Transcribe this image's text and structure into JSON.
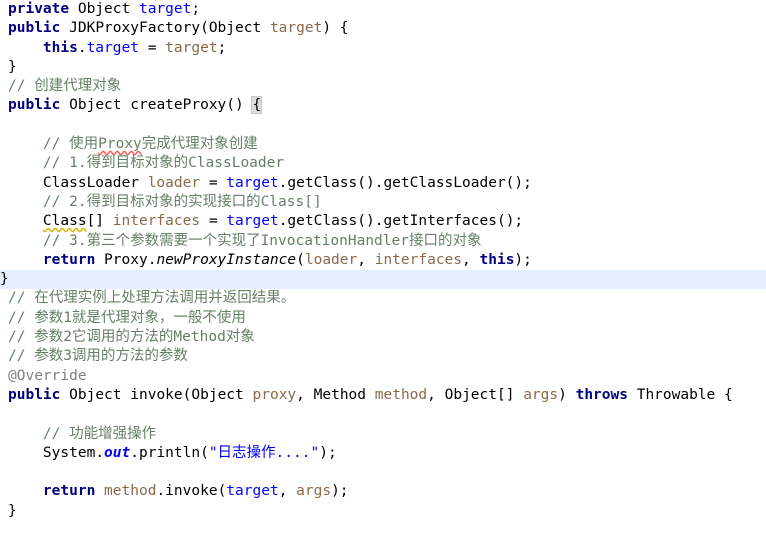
{
  "editor": {
    "language": "Java",
    "theme": "IntelliJ Light",
    "font": "monospace",
    "colors": {
      "background": "#ffffff",
      "foreground": "#000000",
      "keyword": "#000080",
      "field": "#660e7a",
      "field_blue": "#0000ff",
      "parameter": "#8a6a4a",
      "static_field": "#0000ff",
      "string": "#0000ff",
      "comment": "#668066",
      "annotation": "#808080",
      "caret_line_highlight": "#e5efff",
      "brace_match": "#dcdcdc",
      "squiggle_spelling": "#ff5555",
      "squiggle_warning": "#d8b400"
    },
    "highlighted_line_number": 12
  },
  "code": {
    "lines": [
      {
        "n": 1,
        "indent": 0,
        "text": "private Object target;"
      },
      {
        "n": 2,
        "indent": 0,
        "text": "public JDKProxyFactory(Object target) {"
      },
      {
        "n": 3,
        "indent": 1,
        "text": "this.target = target;"
      },
      {
        "n": 4,
        "indent": 0,
        "text": "}"
      },
      {
        "n": 5,
        "indent": 0,
        "text": "// 创建代理对象"
      },
      {
        "n": 6,
        "indent": 0,
        "text": "public Object createProxy() {"
      },
      {
        "n": 7,
        "indent": 0,
        "text": ""
      },
      {
        "n": 8,
        "indent": 1,
        "text": "// 使用Proxy完成代理对象创建"
      },
      {
        "n": 9,
        "indent": 1,
        "text": "// 1.得到目标对象的ClassLoader"
      },
      {
        "n": 10,
        "indent": 1,
        "text": "ClassLoader loader = target.getClass().getClassLoader();"
      },
      {
        "n": 11,
        "indent": 1,
        "text": "// 2.得到目标对象的实现接口的Class[]"
      },
      {
        "n": 12,
        "indent": 1,
        "text": "Class[] interfaces = target.getClass().getInterfaces();"
      },
      {
        "n": 13,
        "indent": 1,
        "text": "// 3.第三个参数需要一个实现了InvocationHandler接口的对象"
      },
      {
        "n": 14,
        "indent": 1,
        "text": "return Proxy.newProxyInstance(loader, interfaces, this);"
      },
      {
        "n": 15,
        "indent": 0,
        "text": "}"
      },
      {
        "n": 16,
        "indent": 0,
        "text": "// 在代理实例上处理方法调用并返回结果。"
      },
      {
        "n": 17,
        "indent": 0,
        "text": "// 参数1就是代理对象，一般不使用"
      },
      {
        "n": 18,
        "indent": 0,
        "text": "// 参数2它调用的方法的Method对象"
      },
      {
        "n": 19,
        "indent": 0,
        "text": "// 参数3调用的方法的参数"
      },
      {
        "n": 20,
        "indent": 0,
        "text": "@Override"
      },
      {
        "n": 21,
        "indent": 0,
        "text": "public Object invoke(Object proxy, Method method, Object[] args) throws Throwable {"
      },
      {
        "n": 22,
        "indent": 0,
        "text": ""
      },
      {
        "n": 23,
        "indent": 1,
        "text": "// 功能增强操作"
      },
      {
        "n": 24,
        "indent": 1,
        "text": "System.out.println(\"日志操作....\");"
      },
      {
        "n": 25,
        "indent": 0,
        "text": ""
      },
      {
        "n": 26,
        "indent": 1,
        "text": "return method.invoke(target, args);"
      },
      {
        "n": 27,
        "indent": 0,
        "text": "}"
      }
    ],
    "tokens": {
      "kw_private": "private",
      "kw_public": "public",
      "kw_return": "return",
      "kw_this": "this",
      "kw_throws": "throws",
      "type_object": "Object",
      "type_classloader": "ClassLoader",
      "type_class": "Class",
      "type_method": "Method",
      "type_proxy": "Proxy",
      "type_system": "System",
      "type_throwable": "Throwable",
      "field_target": "target",
      "var_loader": "loader",
      "var_interfaces": "interfaces",
      "param_proxy": "proxy",
      "param_method": "method",
      "param_args": "args",
      "ctor_name": "JDKProxyFactory",
      "m_createProxy": "createProxy",
      "m_getClass": "getClass",
      "m_getClassLoader": "getClassLoader",
      "m_getInterfaces": "getInterfaces",
      "m_newProxyInstance": "newProxyInstance",
      "m_invoke": "invoke",
      "m_println": "println",
      "f_out": "out",
      "annotation_override": "@Override",
      "string_log": "\"日志操作....\"",
      "string_log_inner": "日志操作....",
      "comment_create_proxy": "// 创建代理对象",
      "comment_use_proxy_a": "// 使用",
      "comment_use_proxy_word": "Proxy",
      "comment_use_proxy_b": "完成代理对象创建",
      "comment_step1": "// 1.得到目标对象的ClassLoader",
      "comment_step2": "// 2.得到目标对象的实现接口的Class[]",
      "comment_step3": "// 3.第三个参数需要一个实现了InvocationHandler接口的对象",
      "comment_handle": "// 在代理实例上处理方法调用并返回结果。",
      "comment_p1": "// 参数1就是代理对象，一般不使用",
      "comment_p2": "// 参数2它调用的方法的Method对象",
      "comment_p3": "// 参数3调用的方法的参数",
      "comment_enhance": "// 功能增强操作"
    }
  }
}
